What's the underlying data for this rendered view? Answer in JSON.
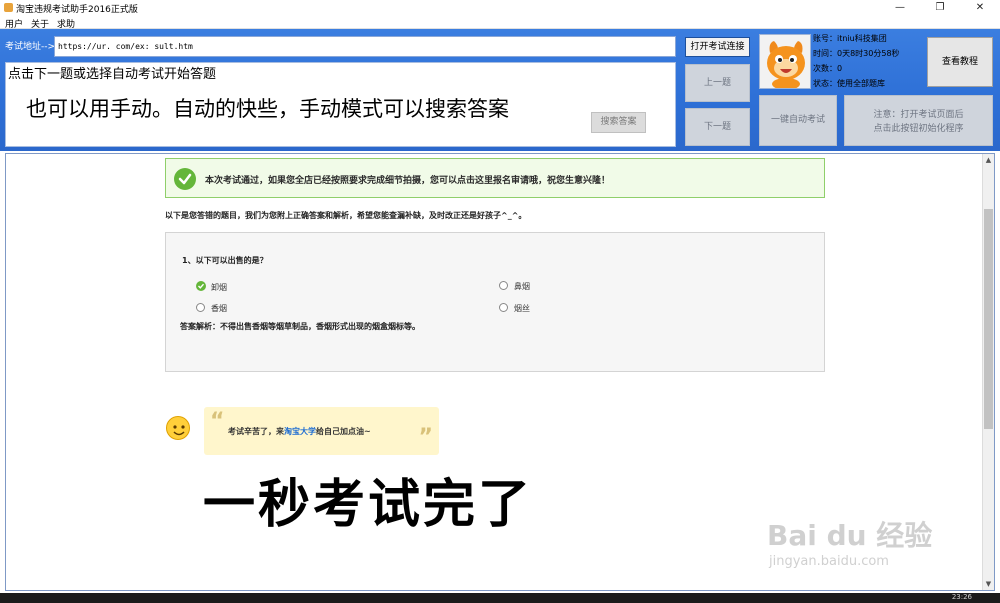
{
  "window": {
    "title": "淘宝违规考试助手2016正式版",
    "minimize": "—",
    "maximize": "❐",
    "close": "✕"
  },
  "menu": [
    "用户",
    "关于",
    "求助"
  ],
  "toolbar": {
    "url_label": "考试地址-->",
    "url_value": "https://ur.        com/ex:        sult.htm",
    "question_hint": "点击下一题或选择自动考试开始答题",
    "overlay_text": "也可以用手动。自动的快些，手动模式可以搜索答案",
    "search_button": "搜索答案",
    "open_button": "打开考试连接",
    "prev_button": "上一题",
    "next_button": "下一题",
    "auto_button": "一键自动考试",
    "note_line1": "注意：打开考试页面后",
    "note_line2": "点击此按钮初始化程序",
    "tutorial_button": "查看教程"
  },
  "account": {
    "account": "账号：itniu科技集团",
    "time": "时间：0天8时30分58秒",
    "count": "次数：0",
    "status": "状态：使用全部题库"
  },
  "result": {
    "success_message": "本次考试通过，如果您全店已经按照要求完成细节拍摄，您可以点击这里报名审请哦，祝您生意兴隆！",
    "wrong_intro": "以下是您答错的题目，我们为您附上正确答案和解析，希望您能查漏补缺，及时改正还是好孩子^_^。",
    "question": "1、以下可以出售的是？",
    "options": [
      "卸烟",
      "鼻烟",
      "香烟",
      "烟丝"
    ],
    "analysis": "答案解析：不得出售香烟等烟草制品，香烟形式出现的烟盒烟标等。",
    "encourage_prefix": "考试辛苦了，来",
    "encourage_link": "淘宝大学",
    "encourage_suffix": "给自己加点油~",
    "big_overlay": "一秒考试完了"
  },
  "watermark": {
    "main": "Bai du 经验",
    "sub": "jingyan.baidu.com"
  },
  "taskbar": {
    "time": "23:26"
  },
  "colors": {
    "panel_blue": "#2d6fd6",
    "success_green": "#64b63a",
    "link_blue": "#1a6ad2"
  }
}
